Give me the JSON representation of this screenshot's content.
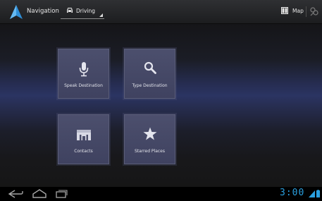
{
  "action_bar": {
    "app_title": "Navigation",
    "mode": {
      "label": "Driving",
      "icon": "car-icon"
    },
    "map_action": {
      "label": "Map",
      "icon": "book-icon"
    },
    "layers_icon": "layers-icon"
  },
  "tiles": [
    {
      "label": "Speak Destination",
      "icon": "microphone-icon"
    },
    {
      "label": "Type Destination",
      "icon": "search-icon"
    },
    {
      "label": "Contacts",
      "icon": "contacts-icon"
    },
    {
      "label": "Starred Places",
      "icon": "star-icon"
    }
  ],
  "system_bar": {
    "clock": "3:00",
    "icons": [
      "back-icon",
      "home-icon",
      "recent-apps-icon",
      "signal-icon",
      "battery-icon"
    ],
    "accent_color": "#2aa0e0"
  },
  "colors": {
    "action_bar": "#242528",
    "tile": "#464966",
    "background_band": "#2b3462"
  }
}
